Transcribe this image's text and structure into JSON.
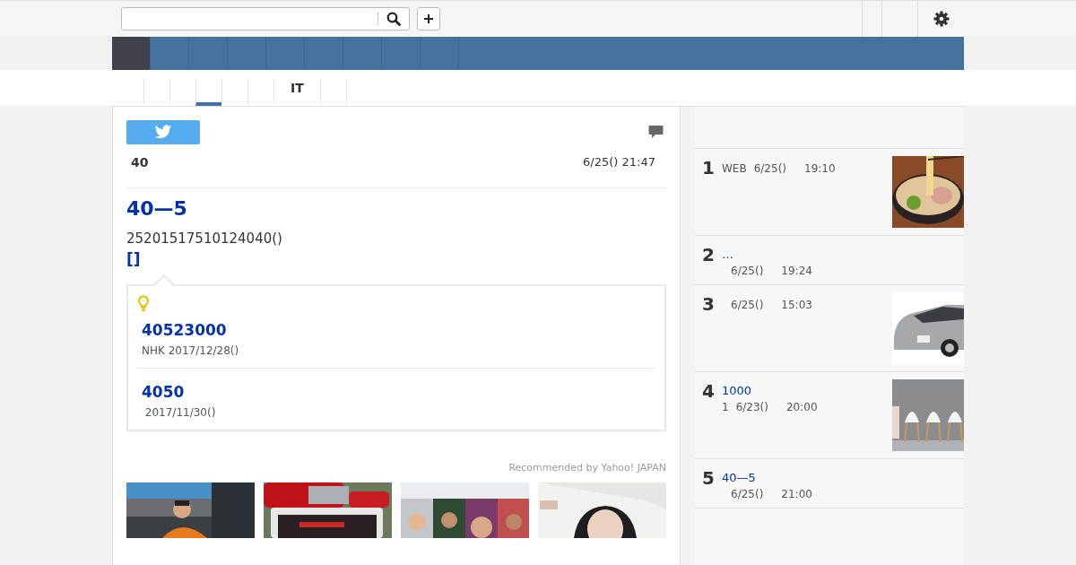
{
  "nav": {
    "items": [
      {
        "selected": true
      },
      {
        "selected": false
      },
      {
        "selected": false
      },
      {
        "selected": false
      },
      {
        "selected": false
      },
      {
        "selected": false
      },
      {
        "selected": false
      },
      {
        "selected": false
      },
      {
        "selected": false
      }
    ]
  },
  "sub_nav": {
    "items": [
      {
        "selected": false
      },
      {
        "selected": false
      },
      {
        "selected": true
      },
      {
        "selected": false
      },
      {
        "selected": false
      },
      {
        "label": "IT",
        "selected": false
      },
      {
        "selected": false
      },
      {
        "selected": false
      }
    ]
  },
  "article": {
    "source": "40",
    "date": "6/25() 21:47",
    "headline": "40—5",
    "body": "25201517510124040()",
    "link": "[]",
    "related": [
      {
        "title": "40523000",
        "meta": "NHK 2017/12/28()"
      },
      {
        "title": "4050",
        "meta": " 2017/11/30()"
      }
    ],
    "recommended": "Recommended by Yahoo! JAPAN"
  },
  "ranking": [
    {
      "rank": "1",
      "source": "WEB",
      "date": "6/25()",
      "time": "19:10",
      "kind": "picture"
    },
    {
      "rank": "2",
      "title": "…",
      "date": "6/25()",
      "time": "19:24"
    },
    {
      "rank": "3",
      "date": "6/25()",
      "time": "15:03",
      "kind": "picture"
    },
    {
      "rank": "4",
      "title": "1000",
      "source": "1",
      "date": "6/23()",
      "time": "20:00",
      "kind": "picture"
    },
    {
      "rank": "5",
      "title": "40—5",
      "date": "6/25()",
      "time": "21:00"
    }
  ]
}
